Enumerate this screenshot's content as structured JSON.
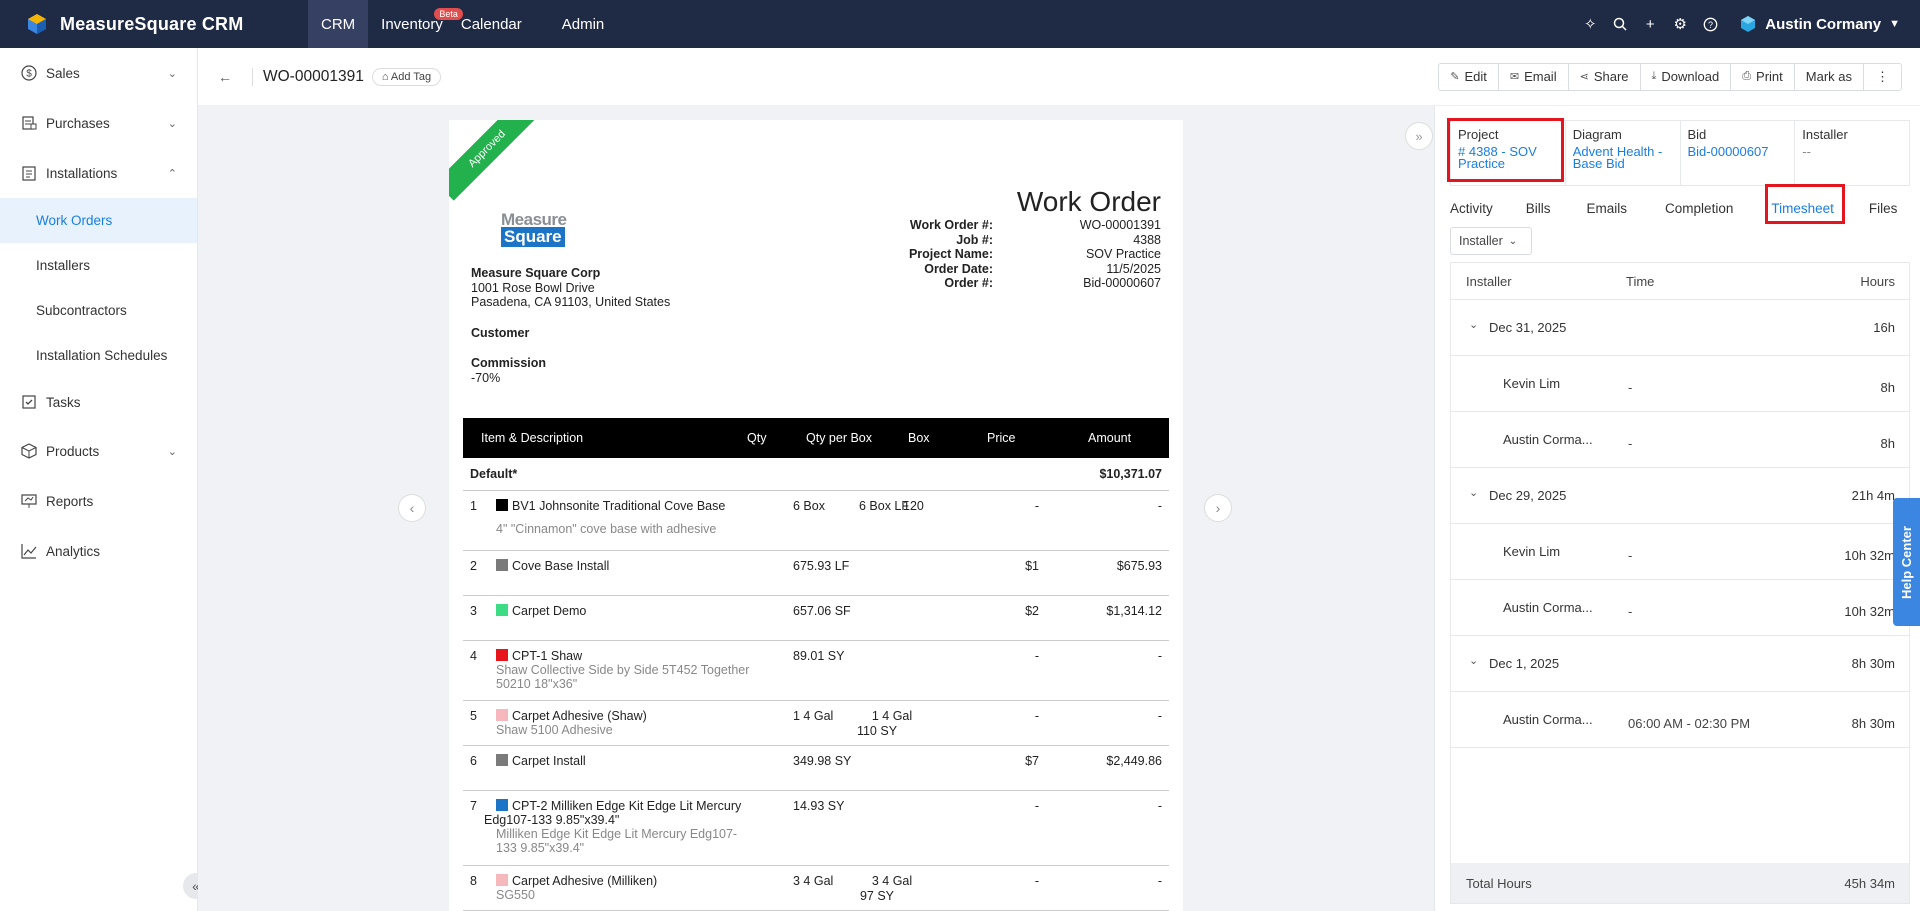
{
  "app": {
    "name": "MeasureSquare CRM"
  },
  "topnav": [
    {
      "label": "CRM"
    },
    {
      "label": "Inventory",
      "badge": "Beta"
    },
    {
      "label": "Calendar"
    },
    {
      "label": "Admin"
    }
  ],
  "user": {
    "name": "Austin Cormany"
  },
  "sidebar": {
    "sales": "Sales",
    "purchases": "Purchases",
    "installations": "Installations",
    "installations_items": [
      "Work Orders",
      "Installers",
      "Subcontractors",
      "Installation Schedules"
    ],
    "tasks": "Tasks",
    "products": "Products",
    "reports": "Reports",
    "analytics": "Analytics"
  },
  "header": {
    "title": "WO-00001391",
    "add_tag": "Add Tag",
    "actions": [
      "Edit",
      "Email",
      "Share",
      "Download",
      "Print",
      "Mark as"
    ]
  },
  "document": {
    "ribbon": "Approved",
    "logo_line1": "Measure",
    "logo_line2": "Square",
    "company_name": "Measure Square Corp",
    "address1": "1001 Rose Bowl Drive",
    "address2": "Pasadena, CA 91103, United States",
    "customer_label": "Customer",
    "commission_label": "Commission",
    "commission_value": "-70%",
    "heading": "Work Order",
    "meta": [
      {
        "k": "Work Order #:",
        "v": "WO-00001391"
      },
      {
        "k": "Job #:",
        "v": "4388"
      },
      {
        "k": "Project Name:",
        "v": "SOV Practice"
      },
      {
        "k": "Order Date:",
        "v": "11/5/2025"
      },
      {
        "k": "Order #:",
        "v": "Bid-00000607"
      }
    ],
    "columns": {
      "item": "Item & Description",
      "qty": "Qty",
      "qty_per_box": "Qty per Box",
      "box": "Box",
      "price": "Price",
      "amount": "Amount"
    },
    "group": {
      "name": "Default*",
      "amount": "$10,371.07"
    },
    "items": [
      {
        "n": "1",
        "color": "#000000",
        "name": "BV1 Johnsonite Traditional Cove Base",
        "desc": "4\" \"Cinnamon\" cove base with adhesive",
        "qty": "6 Box",
        "qpb": "6 Box LF",
        "box": "120",
        "price": "-",
        "amount": "-"
      },
      {
        "n": "2",
        "color": "#7a7a7a",
        "name": "Cove Base Install",
        "desc": "",
        "qty": "675.93 LF",
        "qpb": "",
        "box": "",
        "price": "$1",
        "amount": "$675.93"
      },
      {
        "n": "3",
        "color": "#3ddc84",
        "name": "Carpet Demo",
        "desc": "",
        "qty": "657.06 SF",
        "qpb": "",
        "box": "",
        "price": "$2",
        "amount": "$1,314.12"
      },
      {
        "n": "4",
        "color": "#e8141c",
        "name": "CPT-1 Shaw",
        "desc": "Shaw Collective Side by Side 5T452 Together 50210 18\"x36\"",
        "qty": "89.01 SY",
        "qpb": "",
        "box": "",
        "price": "-",
        "amount": "-"
      },
      {
        "n": "5",
        "color": "#f7b8bd",
        "name": "Carpet Adhesive (Shaw)",
        "desc": "Shaw 5100 Adhesive",
        "qty": "1 4 Gal",
        "qpb": "1 4 Gal",
        "box": "110 SY",
        "price": "-",
        "amount": "-"
      },
      {
        "n": "6",
        "color": "#7a7a7a",
        "name": "Carpet Install",
        "desc": "",
        "qty": "349.98 SY",
        "qpb": "",
        "box": "",
        "price": "$7",
        "amount": "$2,449.86"
      },
      {
        "n": "7",
        "color": "#1b74c5",
        "name": "CPT-2 Milliken Edge Kit Edge Lit Mercury Edg107-133 9.85\"x39.4\"",
        "desc": "Milliken Edge Kit Edge Lit Mercury Edg107-133 9.85\"x39.4\"",
        "qty": "14.93 SY",
        "qpb": "",
        "box": "",
        "price": "-",
        "amount": "-"
      },
      {
        "n": "8",
        "color": "#f7b8bd",
        "name": "Carpet Adhesive (Milliken)",
        "desc": "SG550",
        "qty": "3 4 Gal",
        "qpb": "3 4 Gal",
        "box": "97 SY",
        "price": "-",
        "amount": "-"
      }
    ]
  },
  "panel": {
    "cards": [
      {
        "label": "Project",
        "value": "# 4388 - SOV Practice"
      },
      {
        "label": "Diagram",
        "value": "Advent Health - Base Bid"
      },
      {
        "label": "Bid",
        "value": "Bid-00000607"
      },
      {
        "label": "Installer",
        "value": "--"
      }
    ],
    "tabs": [
      "Activity",
      "Bills",
      "Emails",
      "Completion",
      "Timesheet",
      "Files"
    ],
    "active_tab": "Timesheet",
    "filter": "Installer",
    "timesheet": {
      "columns": {
        "installer": "Installer",
        "time": "Time",
        "hours": "Hours"
      },
      "groups": [
        {
          "date": "Dec 31, 2025",
          "total": "16h",
          "entries": [
            {
              "name": "Kevin Lim",
              "time": "-",
              "hours": "8h"
            },
            {
              "name": "Austin Corma...",
              "time": "-",
              "hours": "8h"
            }
          ]
        },
        {
          "date": "Dec 29, 2025",
          "total": "21h 4m",
          "entries": [
            {
              "name": "Kevin Lim",
              "time": "-",
              "hours": "10h 32m"
            },
            {
              "name": "Austin Corma...",
              "time": "-",
              "hours": "10h 32m"
            }
          ]
        },
        {
          "date": "Dec 1, 2025",
          "total": "8h 30m",
          "entries": [
            {
              "name": "Austin Corma...",
              "time": "06:00 AM - 02:30 PM",
              "hours": "8h 30m"
            }
          ]
        }
      ],
      "footer_label": "Total Hours",
      "footer_value": "45h 34m"
    }
  },
  "help": {
    "label": "Help Center"
  },
  "colors": {
    "topbar": "#1f2a44",
    "accent": "#1a7ee0",
    "highlight": "#e3161f",
    "ribbon": "#22b14c"
  }
}
